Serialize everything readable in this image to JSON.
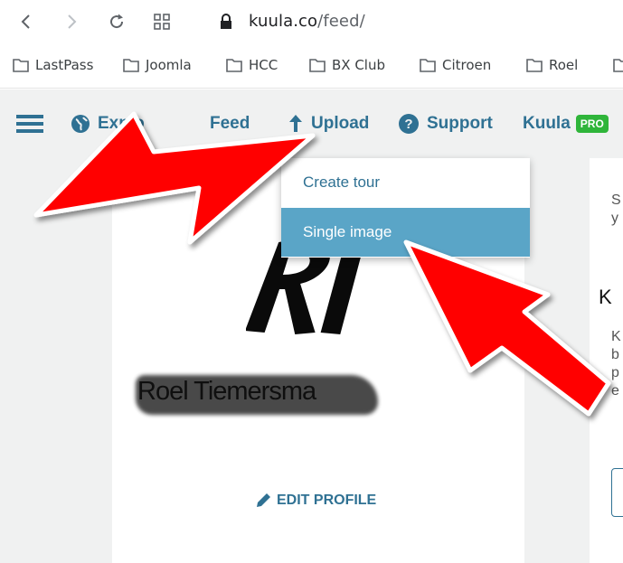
{
  "browser": {
    "url_host": "kuula.co",
    "url_path": "/feed/",
    "bookmarks": [
      "LastPass",
      "Joomla",
      "HCC",
      "BX Club",
      "Citroen",
      "Roel",
      ""
    ]
  },
  "nav": {
    "explore": "Explo",
    "feed": "Feed",
    "upload": "Upload",
    "support": "Support",
    "brand": "Kuula",
    "pro": "PRO"
  },
  "upload_menu": {
    "items": [
      "Create tour",
      "Single image"
    ],
    "selected": "Single image"
  },
  "profile": {
    "name": "Roel Tiemersma",
    "edit_label": "EDIT PROFILE",
    "logo_text": "Ri"
  },
  "right_panel": {
    "line1": "S",
    "line2": "y",
    "heading": "K",
    "para": [
      "K",
      "b",
      "p",
      "e"
    ]
  },
  "colors": {
    "accent": "#2f7193",
    "pro_badge": "#2fb53a",
    "menu_highlight": "#5aa5c7",
    "arrow": "#ff0000"
  }
}
